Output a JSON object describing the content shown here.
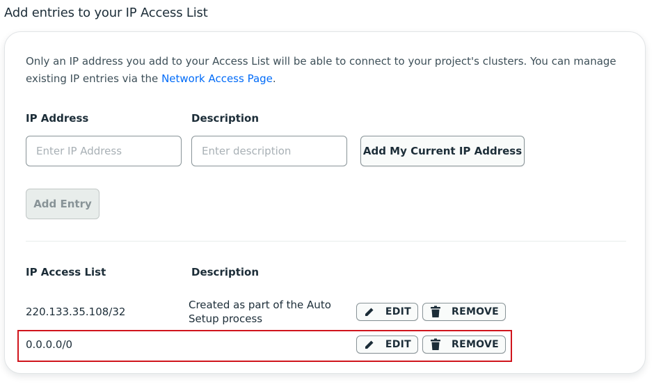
{
  "header": {
    "title": "Add entries to your IP Access List"
  },
  "intro": {
    "text": "Only an IP address you add to your Access List will be able to connect to your project's clusters. You can manage existing IP entries via the ",
    "link": "Network Access Page",
    "end": "."
  },
  "form": {
    "ip_label": "IP Address",
    "desc_label": "Description",
    "ip_placeholder": "Enter IP Address",
    "desc_placeholder": "Enter description",
    "add_current_ip": "Add My Current IP Address",
    "add_entry": "Add Entry"
  },
  "table": {
    "col_ip": "IP Access List",
    "col_desc": "Description",
    "rows": [
      {
        "ip": "220.133.35.108/32",
        "desc": "Created as part of the Auto Setup process",
        "edit": "EDIT",
        "remove": "REMOVE"
      },
      {
        "ip": "0.0.0.0/0",
        "desc": "",
        "edit": "EDIT",
        "remove": "REMOVE"
      }
    ]
  },
  "icons": {
    "edit": "pencil-icon",
    "remove": "trash-icon"
  },
  "colors": {
    "link": "#016bf8",
    "highlight": "#d0141c"
  }
}
